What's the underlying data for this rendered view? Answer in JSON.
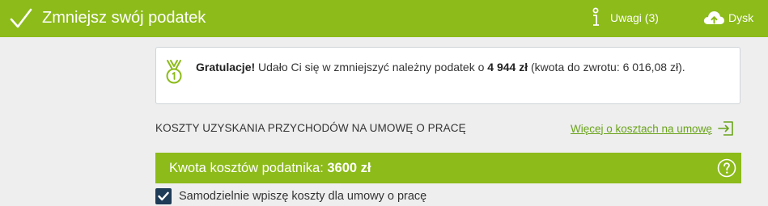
{
  "header": {
    "title": "Zmniejsz swój podatek",
    "notes_label": "Uwagi (3)",
    "disk_label": "Dysk",
    "color": "#8cbb1a"
  },
  "congrats": {
    "lead": "Gratulacje!",
    "text_part1": " Udało Ci się w zmniejszyć należny podatek o ",
    "amount": "4 944 zł",
    "text_part2": " (kwota do zwrotu: 6 016,08 zł)."
  },
  "costs": {
    "section_title": "KOSZTY UZYSKANIA PRZYCHODÓW NA UMOWĘ O PRACĘ",
    "more_link": "Więcej o kosztach na umowę",
    "bar_label": "Kwota kosztów podatnika: ",
    "bar_value": "3600 zł",
    "manual_checkbox_label": "Samodzielnie wpiszę koszty dla umowy o pracę",
    "manual_checked": true
  },
  "icons": {
    "header_check": "checkmark-icon",
    "notes": "info-icon",
    "disk": "cloud-upload-icon",
    "medal": "medal-icon",
    "more_link": "arrow-right-box-icon",
    "help": "question-circle-icon"
  }
}
